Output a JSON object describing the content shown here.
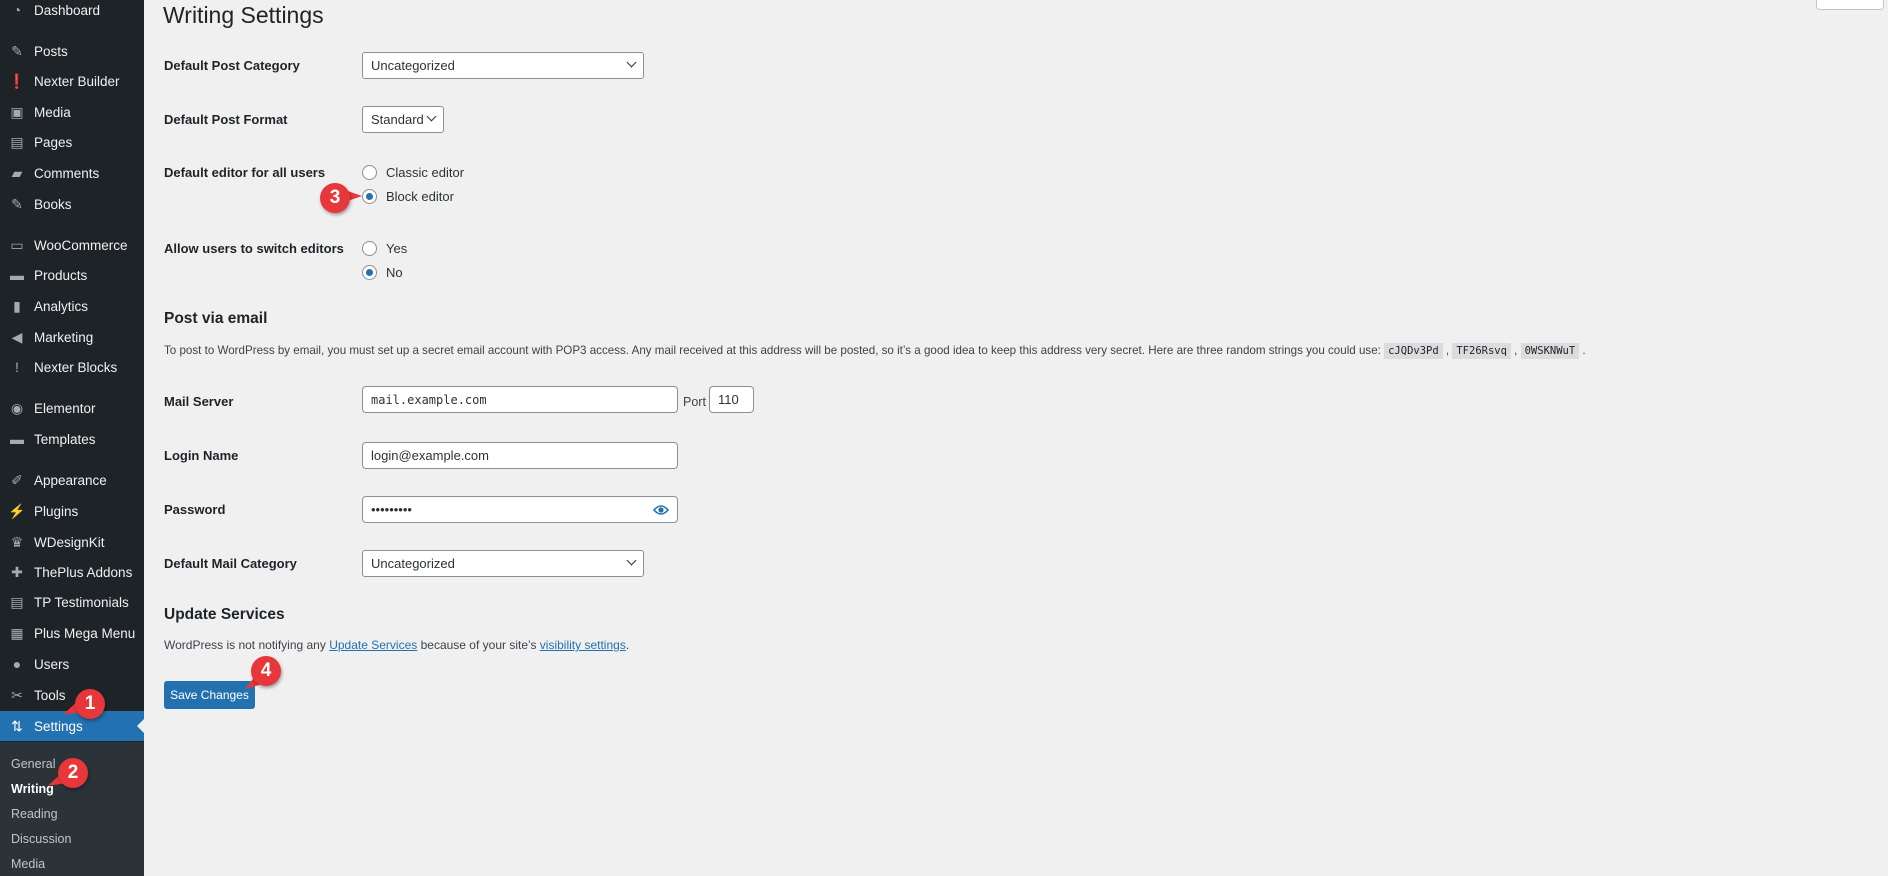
{
  "sidebar": {
    "items": [
      {
        "label": "Dashboard",
        "icon": "dashboard-icon",
        "glyph": "◔"
      },
      {
        "label": "Posts",
        "icon": "pin-icon",
        "glyph": "✎"
      },
      {
        "label": "Nexter Builder",
        "icon": "nexter-builder-icon",
        "glyph": "❗"
      },
      {
        "label": "Media",
        "icon": "media-icon",
        "glyph": "▣"
      },
      {
        "label": "Pages",
        "icon": "pages-icon",
        "glyph": "▤"
      },
      {
        "label": "Comments",
        "icon": "comments-icon",
        "glyph": "▰"
      },
      {
        "label": "Books",
        "icon": "pin-icon",
        "glyph": "✎"
      },
      {
        "label": "WooCommerce",
        "icon": "woocommerce-icon",
        "glyph": "▭"
      },
      {
        "label": "Products",
        "icon": "archive-icon",
        "glyph": "▬"
      },
      {
        "label": "Analytics",
        "icon": "bar-chart-icon",
        "glyph": "▮"
      },
      {
        "label": "Marketing",
        "icon": "megaphone-icon",
        "glyph": "◀"
      },
      {
        "label": "Nexter Blocks",
        "icon": "nexter-blocks-icon",
        "glyph": "!"
      },
      {
        "label": "Elementor",
        "icon": "elementor-icon",
        "glyph": "◉"
      },
      {
        "label": "Templates",
        "icon": "folder-icon",
        "glyph": "▬"
      },
      {
        "label": "Appearance",
        "icon": "brush-icon",
        "glyph": "✐"
      },
      {
        "label": "Plugins",
        "icon": "plug-icon",
        "glyph": "⚡"
      },
      {
        "label": "WDesignKit",
        "icon": "wdesignkit-icon",
        "glyph": "♛"
      },
      {
        "label": "ThePlus Addons",
        "icon": "theplus-icon",
        "glyph": "✚"
      },
      {
        "label": "TP Testimonials",
        "icon": "testimonial-icon",
        "glyph": "▤"
      },
      {
        "label": "Plus Mega Menu",
        "icon": "mega-menu-icon",
        "glyph": "▦"
      },
      {
        "label": "Users",
        "icon": "user-icon",
        "glyph": "●"
      },
      {
        "label": "Tools",
        "icon": "wrench-icon",
        "glyph": "✂"
      },
      {
        "label": "Settings",
        "icon": "settings-icon",
        "glyph": "⇅"
      }
    ],
    "submenu": [
      "General",
      "Writing",
      "Reading",
      "Discussion",
      "Media"
    ]
  },
  "page": {
    "title": "Writing Settings"
  },
  "form": {
    "default_post_category": {
      "label": "Default Post Category",
      "value": "Uncategorized"
    },
    "default_post_format": {
      "label": "Default Post Format",
      "value": "Standard"
    },
    "default_editor": {
      "label": "Default editor for all users",
      "options": [
        "Classic editor",
        "Block editor"
      ],
      "selected": "Block editor"
    },
    "allow_switch": {
      "label": "Allow users to switch editors",
      "options": [
        "Yes",
        "No"
      ],
      "selected": "No"
    }
  },
  "post_via_email": {
    "heading": "Post via email",
    "description": "To post to WordPress by email, you must set up a secret email account with POP3 access. Any mail received at this address will be posted, so it’s a good idea to keep this address very secret. Here are three random strings you could use:",
    "strings": [
      "cJQDv3Pd",
      "TF26Rsvq",
      "0WSKNWuT"
    ],
    "mail_server": {
      "label": "Mail Server",
      "value": "mail.example.com"
    },
    "port": {
      "label": "Port",
      "value": "110"
    },
    "login_name": {
      "label": "Login Name",
      "value": "login@example.com"
    },
    "password": {
      "label": "Password",
      "value": "•••••••••"
    },
    "default_mail_category": {
      "label": "Default Mail Category",
      "value": "Uncategorized"
    }
  },
  "update_services": {
    "heading": "Update Services",
    "text_1": "WordPress is not notifying any",
    "link_1": "Update Services",
    "text_2": "because of your site’s",
    "link_2": "visibility settings",
    "text_3": "."
  },
  "save_label": "Save Changes",
  "annotations": [
    "1",
    "2",
    "3",
    "4"
  ],
  "colors": {
    "accent": "#2271b1",
    "sidebar": "#1d2327",
    "annotation": "#e8373a"
  }
}
